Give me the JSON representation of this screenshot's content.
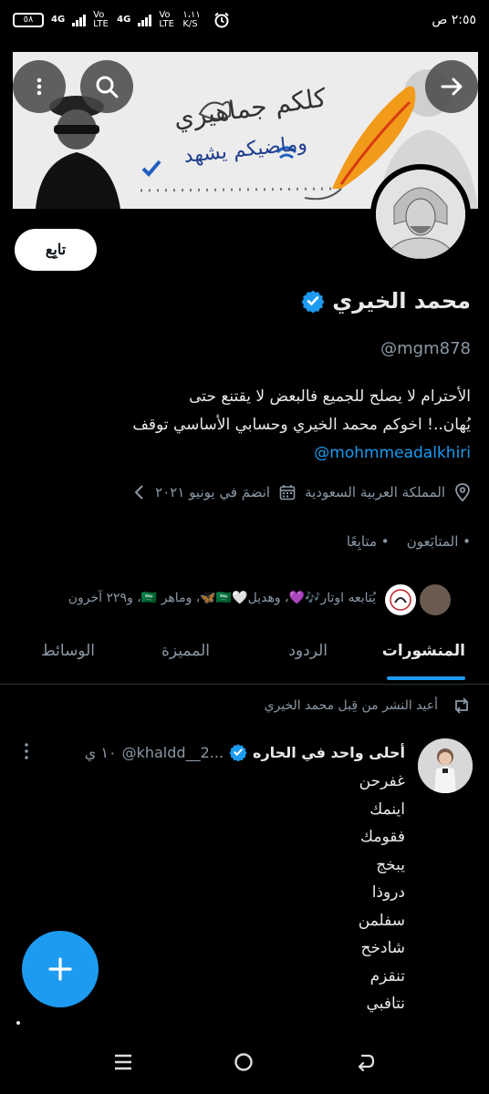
{
  "status_bar": {
    "time": "٢:٥٥ ص",
    "battery": "٥٨",
    "net1": "4G",
    "net2": "4G",
    "volte1": "Vo LTE",
    "volte2": "Vo LTE",
    "speed": "١،١١ K/S"
  },
  "banner": {
    "title": "كلكم جماهيري",
    "subtitle": "وماضيكم يشهد"
  },
  "profile": {
    "follow_label": "تابِع",
    "name": "محمد الخيري",
    "handle": "@mgm878",
    "bio_line1": "الأحترام لا يصلح للجميع فالبعض لا يقتنع حتى",
    "bio_line2": "يُهان..!  اخوكم محمد الخيري وحسابي الأساسي توقف",
    "bio_link": "@mohmmeadalkhiri",
    "location": "المملكة العربية السعودية",
    "joined": "انضمَ في يونيو ٢٠٢١",
    "followers": "المتابَعون",
    "following": "متابِعًا",
    "followed_by": "يُتابعه اوتار🎶💜، وهديل🤍🇸🇦🦋، وماهر 🇸🇦، و٢٢٩ آخرون"
  },
  "tabs": [
    {
      "label": "المنشورات"
    },
    {
      "label": "الردود"
    },
    {
      "label": "المميزة"
    },
    {
      "label": "الوسائط"
    }
  ],
  "tweet": {
    "repost_label": "أعيد النشر من قِبل محمد الخيري",
    "author_name": "أحلى واحد في الحاره",
    "author_handle": "@khaldd__2...",
    "time": "١٠ ي",
    "body": "غفرحن\nاينمك\nفقومك\nيبخج\nدروذا\nسفلمن\nشادخح\nتنقزم\nنتافبي"
  },
  "colors": {
    "accent": "#1d9bf0",
    "background": "#000000",
    "text": "#e7e9ea",
    "muted": "#8b98a5"
  }
}
